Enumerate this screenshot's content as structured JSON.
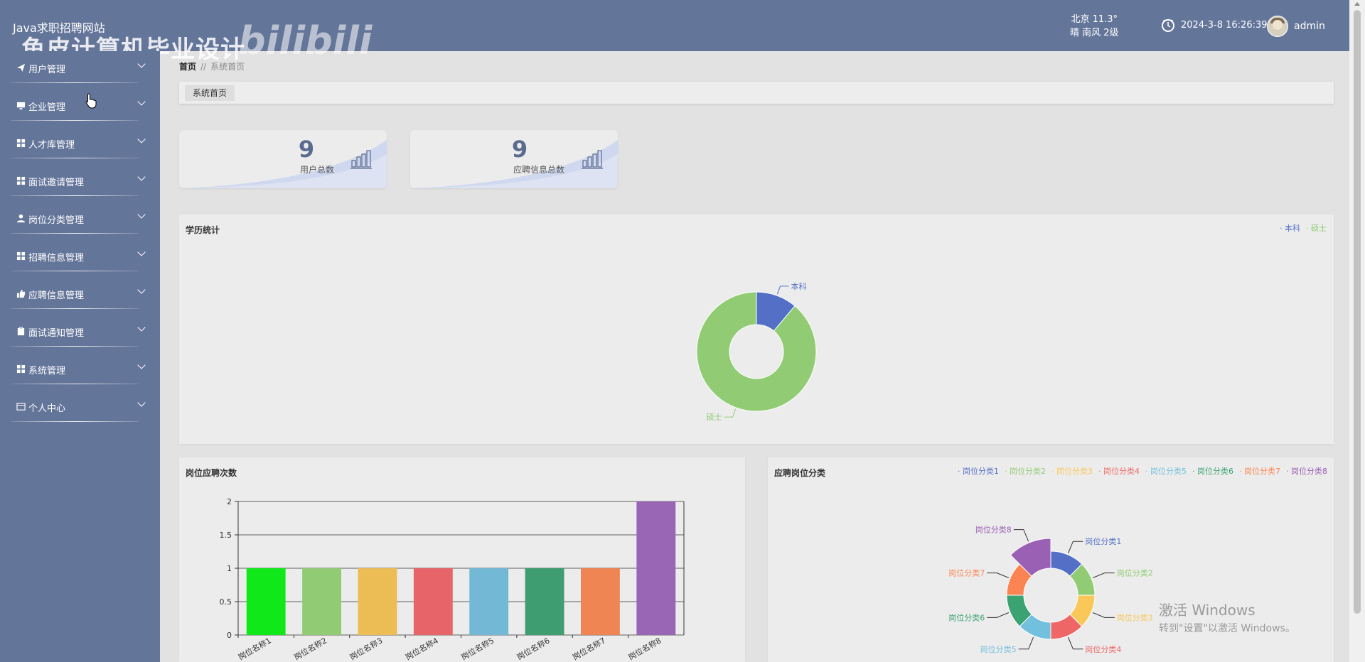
{
  "header": {
    "site_title": "Java求职招聘网站",
    "watermark_text": "鱼皮计算机毕业设计",
    "watermark_logo": "bilibili",
    "weather_line1": "北京  11.3°",
    "weather_line2": "晴  南风  2级",
    "datetime": "2024-3-8 16:26:39",
    "username": "admin"
  },
  "sidebar": {
    "items": [
      {
        "label": "用户管理",
        "icon": "paper-plane-icon"
      },
      {
        "label": "企业管理",
        "icon": "monitor-icon"
      },
      {
        "label": "人才库管理",
        "icon": "grid-icon"
      },
      {
        "label": "面试邀请管理",
        "icon": "grid-icon"
      },
      {
        "label": "岗位分类管理",
        "icon": "user-icon"
      },
      {
        "label": "招聘信息管理",
        "icon": "grid-icon"
      },
      {
        "label": "应聘信息管理",
        "icon": "thumbs-up-icon"
      },
      {
        "label": "面试通知管理",
        "icon": "clipboard-icon"
      },
      {
        "label": "系统管理",
        "icon": "grid-icon"
      },
      {
        "label": "个人中心",
        "icon": "id-card-icon"
      }
    ]
  },
  "breadcrumb": {
    "home": "首页",
    "separator": "//",
    "current": "系统首页"
  },
  "tabs": [
    {
      "label": "系统首页"
    }
  ],
  "stats": [
    {
      "value": "9",
      "label": "用户总数"
    },
    {
      "value": "9",
      "label": "应聘信息总数"
    }
  ],
  "colors": {
    "sidebar": "#64759a",
    "accent": "#5470c6",
    "green": "#91cc75"
  },
  "education_chart": {
    "title": "学历统计",
    "legend": [
      "本科",
      "硕士"
    ]
  },
  "job_count_chart": {
    "title": "岗位应聘次数"
  },
  "job_category_chart": {
    "title": "应聘岗位分类"
  },
  "chart_data": [
    {
      "type": "pie",
      "title": "学历统计",
      "labels": [
        "本科",
        "硕士"
      ],
      "values": [
        1,
        8
      ],
      "colors": [
        "#5470c6",
        "#91cc75"
      ],
      "legend_position": "top-right"
    },
    {
      "type": "bar",
      "title": "岗位应聘次数",
      "categories": [
        "岗位名称1",
        "岗位名称2",
        "岗位名称3",
        "岗位名称4",
        "岗位名称5",
        "岗位名称6",
        "岗位名称7",
        "岗位名称8"
      ],
      "values": [
        1,
        1,
        1,
        1,
        1,
        1,
        1,
        2
      ],
      "colors": [
        "#10e81a",
        "#91cc75",
        "#ecbd55",
        "#e76469",
        "#73b8d5",
        "#3f9d72",
        "#ee8553",
        "#9966b5"
      ],
      "yticks": [
        "0",
        "0.5",
        "1",
        "1.5",
        "2"
      ],
      "ylim": [
        0,
        2
      ],
      "grid": true
    },
    {
      "type": "pie",
      "title": "应聘岗位分类",
      "labels": [
        "岗位分类1",
        "岗位分类2",
        "岗位分类3",
        "岗位分类4",
        "岗位分类5",
        "岗位分类6",
        "岗位分类7",
        "岗位分类8"
      ],
      "values": [
        1,
        1,
        1,
        1,
        1,
        1,
        1,
        2
      ],
      "colors": [
        "#5470c6",
        "#91cc75",
        "#fac858",
        "#ee6666",
        "#73c0de",
        "#3ba272",
        "#fc8452",
        "#9a60b4"
      ],
      "rose_type": true,
      "legend_position": "top-right"
    }
  ],
  "windows_watermark": {
    "line1": "激活 Windows",
    "line2": "转到\"设置\"以激活 Windows。"
  }
}
